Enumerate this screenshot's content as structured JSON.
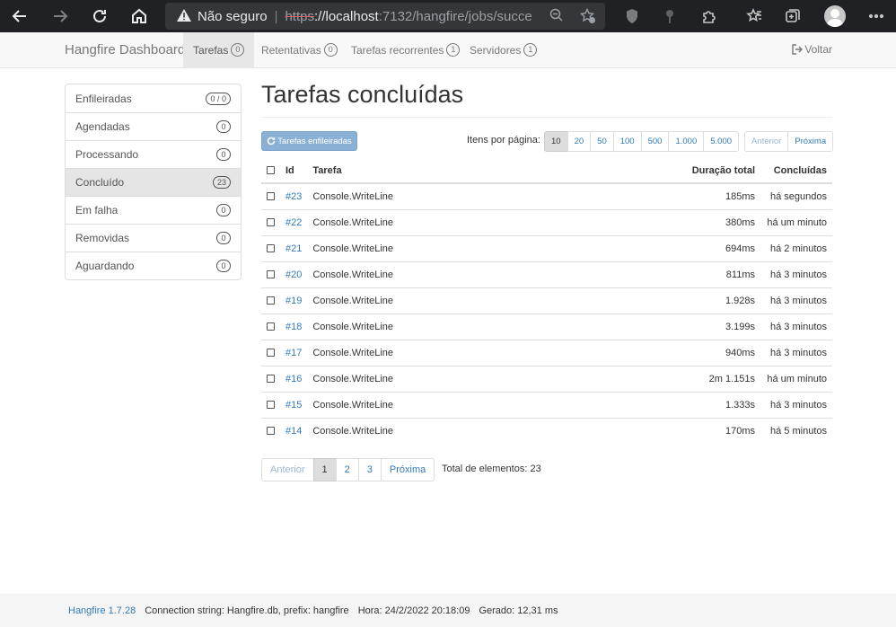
{
  "browser": {
    "security_label": "Não seguro",
    "url_proto": "https",
    "url_host": "://localhost",
    "url_rest": ":7132/hangfire/jobs/succe..."
  },
  "navbar": {
    "brand": "Hangfire Dashboard",
    "items": [
      {
        "label": "Tarefas",
        "count": "0"
      },
      {
        "label": "Retentativas",
        "count": "0"
      },
      {
        "label": "Tarefas recorrentes",
        "count": "1"
      },
      {
        "label": "Servidores",
        "count": "1"
      }
    ],
    "back_label": "Voltar"
  },
  "sidebar": {
    "items": [
      {
        "label": "Enfileiradas",
        "count": "0 / 0"
      },
      {
        "label": "Agendadas",
        "count": "0"
      },
      {
        "label": "Processando",
        "count": "0"
      },
      {
        "label": "Concluído",
        "count": "23"
      },
      {
        "label": "Em falha",
        "count": "0"
      },
      {
        "label": "Removidas",
        "count": "0"
      },
      {
        "label": "Aguardando",
        "count": "0"
      }
    ]
  },
  "main": {
    "title": "Tarefas concluídas",
    "requeue_label": "Tarefas enfileiradas",
    "per_page_label": "Itens por página:",
    "page_sizes": [
      "10",
      "20",
      "50",
      "100",
      "500",
      "1.000",
      "5.000"
    ],
    "prev_label": "Anterior",
    "next_label": "Próxima",
    "columns": {
      "id": "Id",
      "job": "Tarefa",
      "duration": "Duração total",
      "succeeded": "Concluídas"
    },
    "rows": [
      {
        "id": "#23",
        "job": "Console.WriteLine",
        "duration": "185ms",
        "when": "há segundos"
      },
      {
        "id": "#22",
        "job": "Console.WriteLine",
        "duration": "380ms",
        "when": "há um minuto"
      },
      {
        "id": "#21",
        "job": "Console.WriteLine",
        "duration": "694ms",
        "when": "há 2 minutos"
      },
      {
        "id": "#20",
        "job": "Console.WriteLine",
        "duration": "811ms",
        "when": "há 3 minutos"
      },
      {
        "id": "#19",
        "job": "Console.WriteLine",
        "duration": "1.928s",
        "when": "há 3 minutos"
      },
      {
        "id": "#18",
        "job": "Console.WriteLine",
        "duration": "3.199s",
        "when": "há 3 minutos"
      },
      {
        "id": "#17",
        "job": "Console.WriteLine",
        "duration": "940ms",
        "when": "há 3 minutos"
      },
      {
        "id": "#16",
        "job": "Console.WriteLine",
        "duration": "2m 1.151s",
        "when": "há um minuto"
      },
      {
        "id": "#15",
        "job": "Console.WriteLine",
        "duration": "1.333s",
        "when": "há 3 minutos"
      },
      {
        "id": "#14",
        "job": "Console.WriteLine",
        "duration": "170ms",
        "when": "há 5 minutos"
      }
    ],
    "pages": [
      "1",
      "2",
      "3"
    ],
    "total_label": "Total de elementos: 23"
  },
  "footer": {
    "version": "Hangfire 1.7.28",
    "connection": "Connection string: Hangfire.db, prefix: hangfire",
    "time": "Hora: 24/2/2022 20:18:09",
    "generated": "Gerado: 12,31 ms"
  }
}
